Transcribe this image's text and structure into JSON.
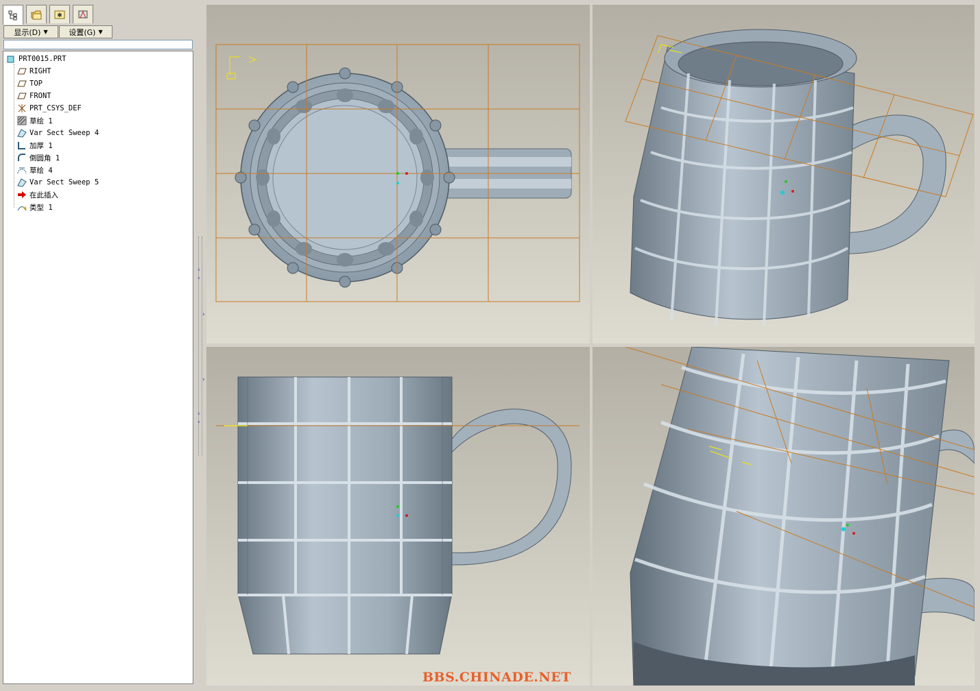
{
  "toolbar": {
    "display_label": "显示(D)",
    "settings_label": "设置(G)"
  },
  "tree": {
    "root": "PRT0015.PRT",
    "items": [
      {
        "label": "RIGHT",
        "icon": "datum-plane-icon"
      },
      {
        "label": "TOP",
        "icon": "datum-plane-icon"
      },
      {
        "label": "FRONT",
        "icon": "datum-plane-icon"
      },
      {
        "label": "PRT_CSYS_DEF",
        "icon": "csys-icon"
      },
      {
        "label": "草绘 1",
        "icon": "sketch-icon"
      },
      {
        "label": "Var Sect Sweep 4",
        "icon": "sweep-icon"
      },
      {
        "label": "加厚 1",
        "icon": "thicken-icon"
      },
      {
        "label": "倒圆角 1",
        "icon": "round-icon"
      },
      {
        "label": "草绘 4",
        "icon": "sketch-icon"
      },
      {
        "label": "Var Sect Sweep 5",
        "icon": "sweep-icon"
      },
      {
        "label": "在此插入",
        "icon": "insert-here-arrow-icon"
      },
      {
        "label": "类型 1",
        "icon": "style-feature-icon"
      }
    ]
  },
  "watermark": "BBS.CHINADE.NET",
  "colors": {
    "model": "#a9b7c2",
    "datum": "#c87b25",
    "insert_arrow": "#d40000"
  }
}
